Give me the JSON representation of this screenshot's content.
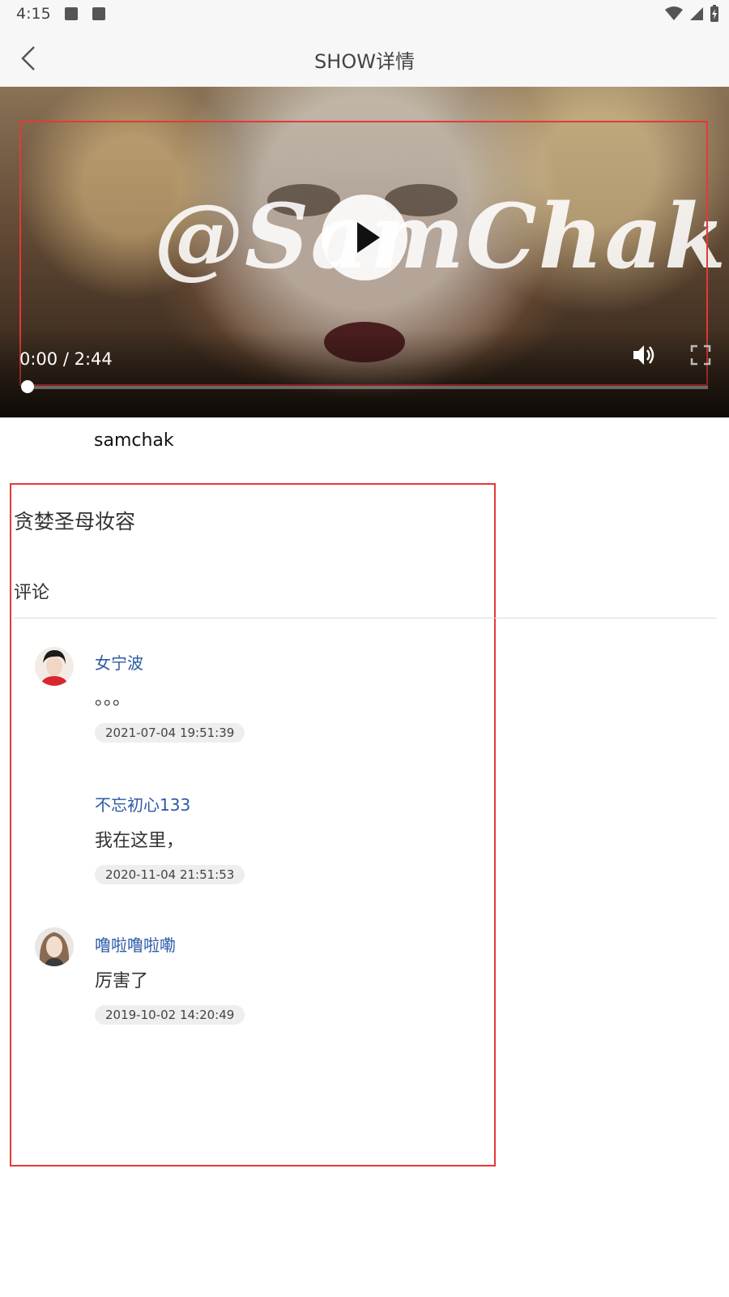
{
  "status_bar": {
    "time": "4:15"
  },
  "header": {
    "title": "SHOW详情"
  },
  "video": {
    "watermark": "@SamChak",
    "time_label": "0:00 / 2:44",
    "progress_fraction": 0.0
  },
  "author": "samchak",
  "show_title": "贪婪圣母妆容",
  "comments_section": {
    "title": "评论",
    "items": [
      {
        "user": "女宁波",
        "text": "。。。",
        "time": "2021-07-04 19:51:39"
      },
      {
        "user": "不忘初心133",
        "text": "我在这里，",
        "time": "2020-11-04 21:51:53"
      },
      {
        "user": "噜啦噜啦嘞",
        "text": "厉害了",
        "time": "2019-10-02 14:20:49"
      }
    ]
  }
}
